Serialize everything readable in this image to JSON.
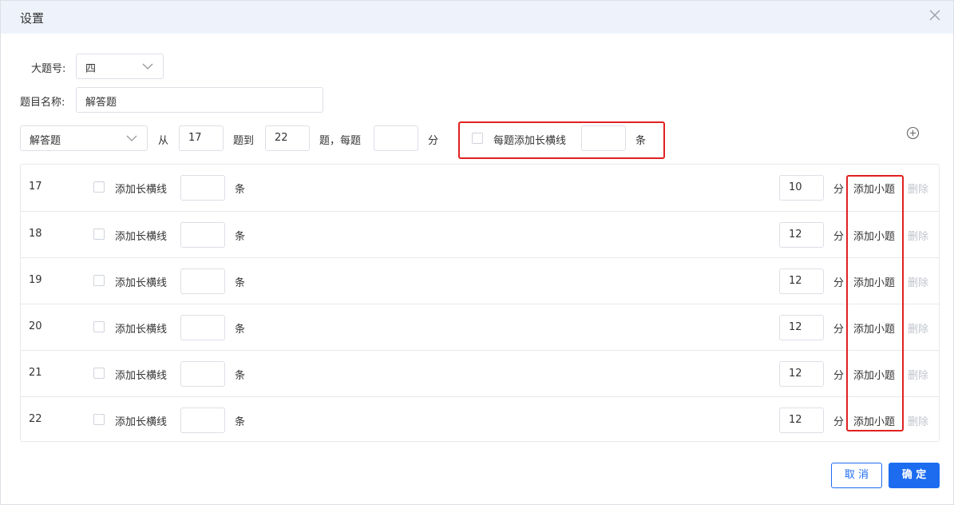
{
  "dialog": {
    "title": "设置"
  },
  "form": {
    "main_no_label": "大题号:",
    "main_no_value": "四",
    "name_label": "题目名称:",
    "name_value": "解答题",
    "type_value": "解答题",
    "from_label": "从",
    "from_value": "17",
    "to_label": "题到",
    "to_value": "22",
    "each_label": "题，每题",
    "each_value": "",
    "fen_label": "分",
    "add_line_label": "每题添加长横线",
    "add_line_value": "",
    "tiao_label": "条"
  },
  "rows": [
    {
      "no": "17",
      "add_long": "添加长横线",
      "lines": "",
      "tiao": "条",
      "score": "10",
      "fen": "分",
      "add_sub": "添加小题",
      "delete": "删除"
    },
    {
      "no": "18",
      "add_long": "添加长横线",
      "lines": "",
      "tiao": "条",
      "score": "12",
      "fen": "分",
      "add_sub": "添加小题",
      "delete": "删除"
    },
    {
      "no": "19",
      "add_long": "添加长横线",
      "lines": "",
      "tiao": "条",
      "score": "12",
      "fen": "分",
      "add_sub": "添加小题",
      "delete": "删除"
    },
    {
      "no": "20",
      "add_long": "添加长横线",
      "lines": "",
      "tiao": "条",
      "score": "12",
      "fen": "分",
      "add_sub": "添加小题",
      "delete": "删除"
    },
    {
      "no": "21",
      "add_long": "添加长横线",
      "lines": "",
      "tiao": "条",
      "score": "12",
      "fen": "分",
      "add_sub": "添加小题",
      "delete": "删除"
    },
    {
      "no": "22",
      "add_long": "添加长横线",
      "lines": "",
      "tiao": "条",
      "score": "12",
      "fen": "分",
      "add_sub": "添加小题",
      "delete": "删除"
    }
  ],
  "footer": {
    "cancel_label": "取 消",
    "ok_label": "确 定"
  },
  "colors": {
    "primary": "#1d6cf0",
    "highlight": "#e02020",
    "header_bg": "#eef3fb"
  },
  "icons": {
    "close": "close-icon",
    "chevron": "chevron-down-icon",
    "add": "plus-circle-icon"
  }
}
